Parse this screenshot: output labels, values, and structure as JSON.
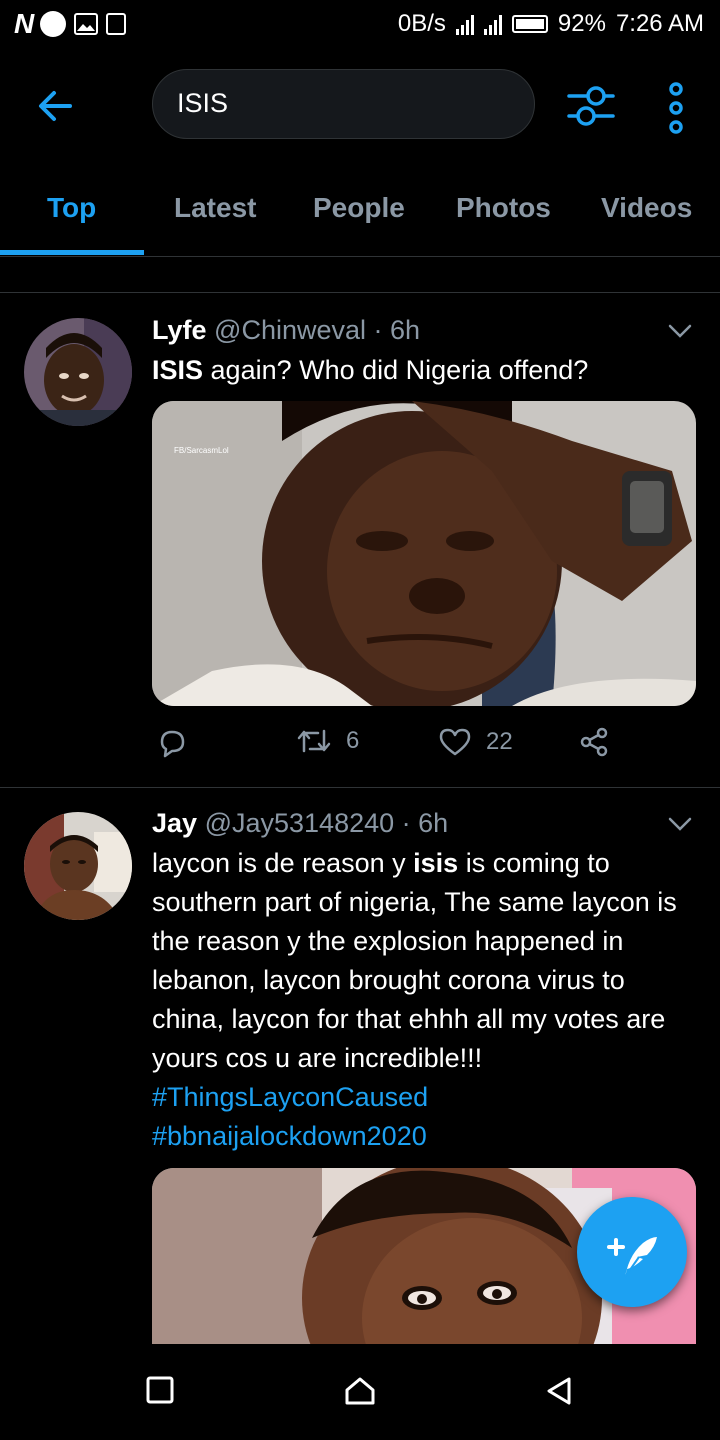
{
  "status_bar": {
    "net_speed": "0B/s",
    "battery": "92%",
    "time": "7:26 AM"
  },
  "search": {
    "query": "ISIS"
  },
  "tabs": [
    {
      "label": "Top",
      "active": true
    },
    {
      "label": "Latest",
      "active": false
    },
    {
      "label": "People",
      "active": false
    },
    {
      "label": "Photos",
      "active": false
    },
    {
      "label": "Videos",
      "active": false
    }
  ],
  "tweets": [
    {
      "name": "Lyfe",
      "handle": "@Chinweval",
      "time": "· 6h",
      "text_bold": "ISIS",
      "text_rest": " again? Who did Nigeria offend?",
      "media_watermark": "FB/SarcasmLol",
      "retweets": "6",
      "likes": "22"
    },
    {
      "name": "Jay",
      "handle": "@Jay53148240",
      "time": "· 6h",
      "text_pre": "laycon is de reason y ",
      "text_bold": "isis",
      "text_post": " is coming to southern part of nigeria, The same laycon is the reason y the explosion happened in lebanon, laycon brought corona virus to china, laycon for that ehhh all my votes are yours cos u are incredible!!! ",
      "hashtag_1": "#ThingsLayconCaused",
      "hashtag_2": "#bbnaijalockdown2020"
    }
  ],
  "icons": {
    "back": "arrow-left-icon",
    "filter": "sliders-icon",
    "more": "more-vertical-icon",
    "compose": "feather-plus-icon",
    "reply": "comment-icon",
    "retweet": "retweet-icon",
    "like": "heart-icon",
    "share": "share-icon"
  },
  "colors": {
    "accent": "#1da1f2",
    "secondary_text": "#8b98a5",
    "background": "#000000",
    "divider": "#2f3336"
  }
}
